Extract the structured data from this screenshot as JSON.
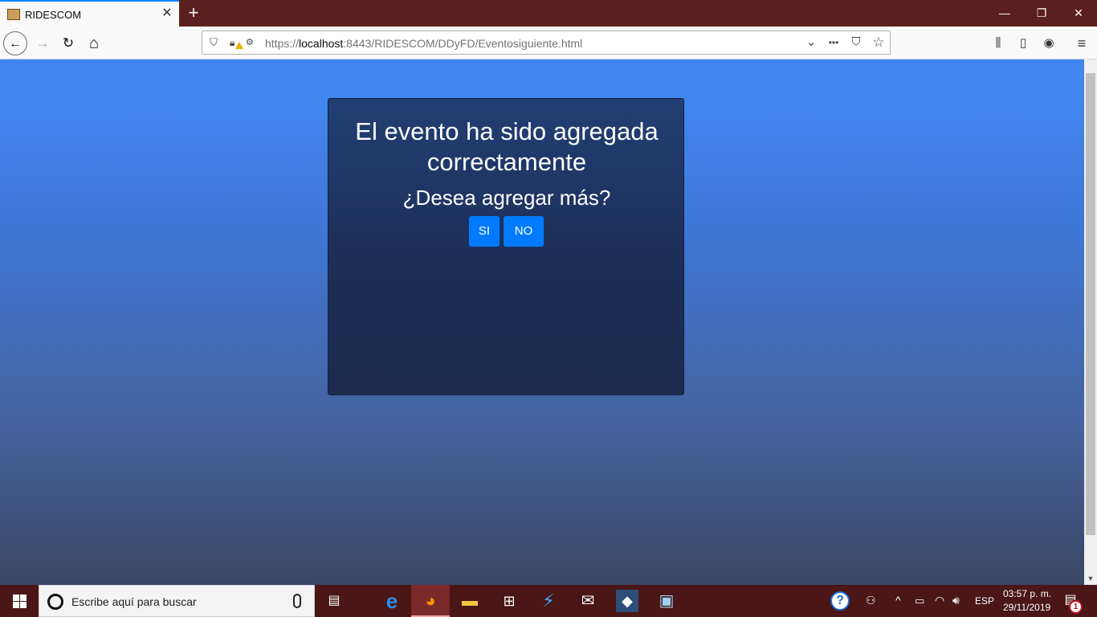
{
  "tab": {
    "title": "RIDESCOM",
    "close": "✕"
  },
  "new_tab": "+",
  "window": {
    "minimize": "—",
    "restore": "❐",
    "close": "✕"
  },
  "nav": {
    "back": "←",
    "forward": "→",
    "reload": "↻",
    "home": "⌂"
  },
  "url": {
    "prefix": "https://",
    "host": "localhost",
    "rest": ":8443/RIDESCOM/DDyFD/Eventosiguiente.html"
  },
  "toolbar_icons": {
    "dropdown": "⌄",
    "more": "•••",
    "pocket": "⛉",
    "bookmark": "☆",
    "library": "⫼",
    "sidebar": "▯",
    "account": "◉",
    "menu": "≡"
  },
  "dialog": {
    "title": "El evento ha sido agregada correctamente",
    "question": "¿Desea agregar más?",
    "yes_label": "SI",
    "no_label": "NO"
  },
  "taskbar": {
    "search_placeholder": "Escribe aquí para buscar",
    "language": "ESP",
    "time": "03:57 p. m.",
    "date": "29/11/2019",
    "notification_count": "1"
  },
  "colors": {
    "accent": "#007bff",
    "page_top": "#4186f0",
    "dialog_bg": "#1f3460",
    "tab_strip": "#5b1f1f"
  }
}
